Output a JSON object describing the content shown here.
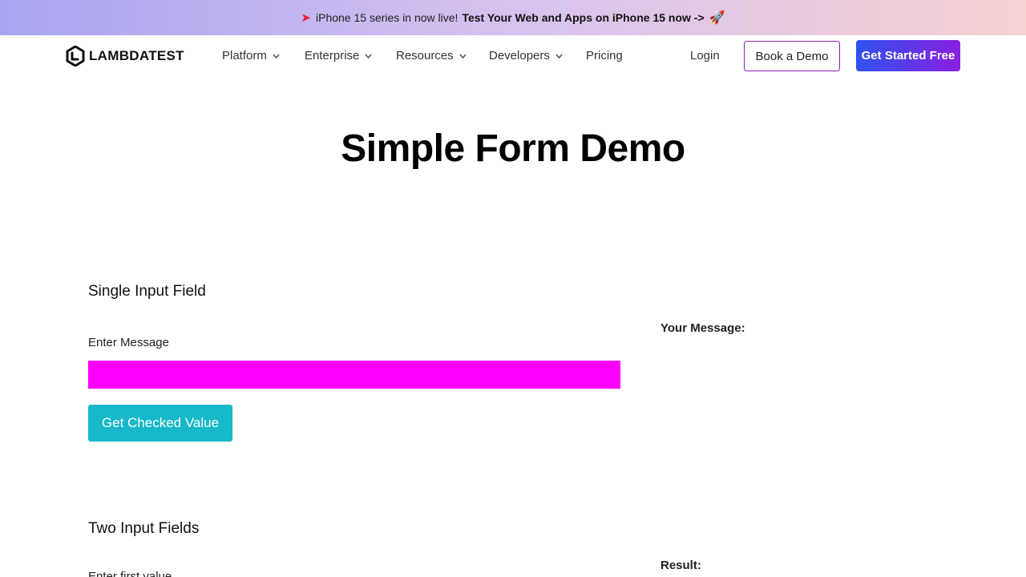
{
  "promo": {
    "text": "iPhone 15 series in now live!",
    "link": "Test Your Web and Apps on iPhone 15 now ->",
    "icon_left": "tag-icon",
    "icon_right": "rocket-icon"
  },
  "header": {
    "logo_text": "LAMBDATEST",
    "nav": [
      {
        "label": "Platform",
        "has_dropdown": true
      },
      {
        "label": "Enterprise",
        "has_dropdown": true
      },
      {
        "label": "Resources",
        "has_dropdown": true
      },
      {
        "label": "Developers",
        "has_dropdown": true
      },
      {
        "label": "Pricing",
        "has_dropdown": false
      }
    ],
    "login": "Login",
    "book_demo": "Book a Demo",
    "get_started": "Get Started Free"
  },
  "page": {
    "title": "Simple Form Demo"
  },
  "single_input": {
    "section_title": "Single Input Field",
    "label": "Enter Message",
    "value": "",
    "button": "Get Checked Value",
    "result_label": "Your Message:"
  },
  "two_inputs": {
    "section_title": "Two Input Fields",
    "first_label": "Enter first value",
    "result_label": "Result:"
  },
  "colors": {
    "accent_input": "#ff00ff",
    "button_teal": "#17b8c9",
    "cta_gradient_start": "#2f52ef",
    "cta_gradient_end": "#8a1fe0",
    "demo_border": "#8a1fb5"
  }
}
